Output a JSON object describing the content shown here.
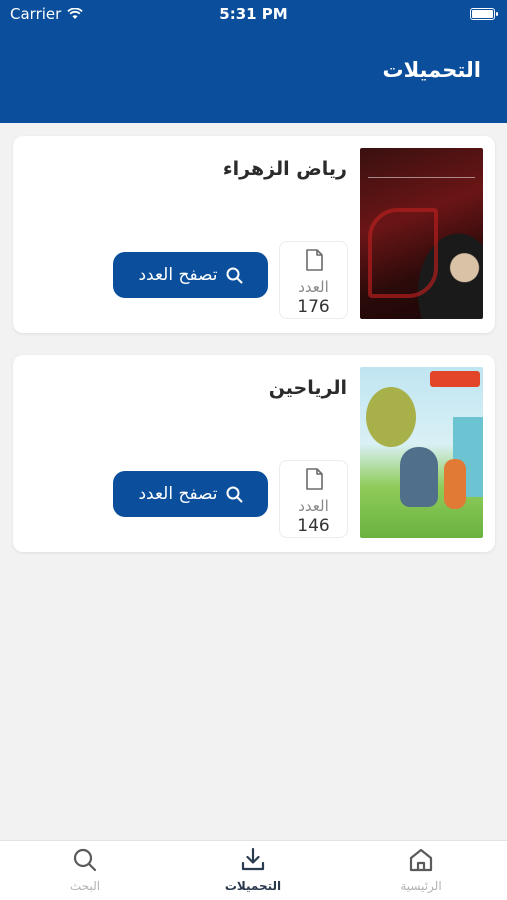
{
  "status_bar": {
    "carrier": "Carrier",
    "time": "5:31 PM"
  },
  "header": {
    "title": "التحميلات"
  },
  "colors": {
    "primary": "#0b4f9c",
    "background": "#f2f2f2"
  },
  "downloads": [
    {
      "title": "رياض الزهراء",
      "issue_label": "العدد",
      "issue_number": "176",
      "button_label": "تصفح العدد",
      "button_icon": "search-icon",
      "cover": "magazine-cover-riyad-alzahraa"
    },
    {
      "title": "الرياحين",
      "issue_label": "العدد",
      "issue_number": "146",
      "button_label": "تصفح العدد",
      "button_icon": "search-icon",
      "cover": "magazine-cover-alrayaheen"
    }
  ],
  "tab_bar": {
    "tabs": [
      {
        "label": "البحث",
        "icon": "search-icon",
        "active": false
      },
      {
        "label": "التحميلات",
        "icon": "download-icon",
        "active": true
      },
      {
        "label": "الرئيسية",
        "icon": "home-icon",
        "active": false
      }
    ]
  }
}
